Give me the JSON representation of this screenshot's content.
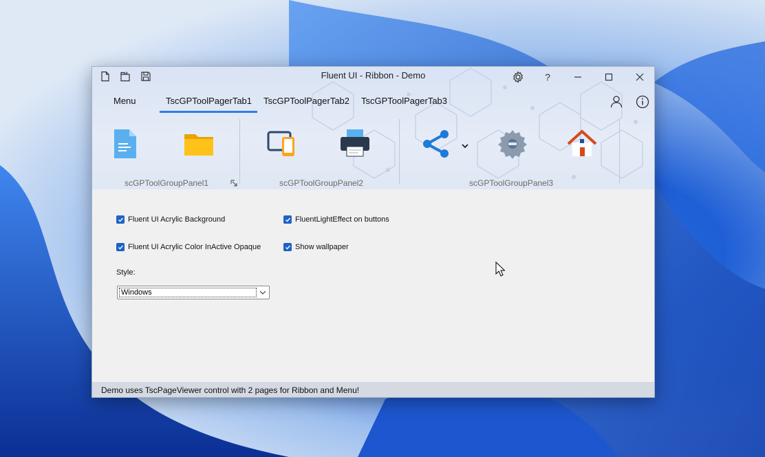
{
  "window": {
    "title": "Fluent UI - Ribbon - Demo"
  },
  "quick_access": [
    {
      "name": "new-file-icon"
    },
    {
      "name": "open-file-icon"
    },
    {
      "name": "save-icon"
    }
  ],
  "system_buttons": {
    "help_label": "?"
  },
  "tabs": {
    "menu_label": "Menu",
    "items": [
      {
        "label": "TscGPToolPagerTab1",
        "active": true
      },
      {
        "label": "TscGPToolPagerTab2",
        "active": false
      },
      {
        "label": "TscGPToolPagerTab3",
        "active": false
      }
    ]
  },
  "panels": [
    {
      "label": "scGPToolGroupPanel1"
    },
    {
      "label": "scGPToolGroupPanel2"
    },
    {
      "label": "scGPToolGroupPanel3"
    }
  ],
  "options": {
    "acrylic_background": {
      "label": "Fluent UI Acrylic Background",
      "checked": true
    },
    "light_effect": {
      "label": "FluentLightEffect on buttons",
      "checked": true
    },
    "acrylic_inactive_opaque": {
      "label": "Fluent UI Acrylic Color InActive Opaque",
      "checked": true
    },
    "show_wallpaper": {
      "label": "Show wallpaper",
      "checked": true
    }
  },
  "style": {
    "label": "Style:",
    "selected": "Windows"
  },
  "statusbar": {
    "text": "Demo uses TscPageViewer control with 2 pages for Ribbon and Menu!"
  },
  "colors": {
    "accent": "#2f7ee6",
    "checkbox": "#1f62c6",
    "wallpaper_blue": "#1f5fd6"
  }
}
